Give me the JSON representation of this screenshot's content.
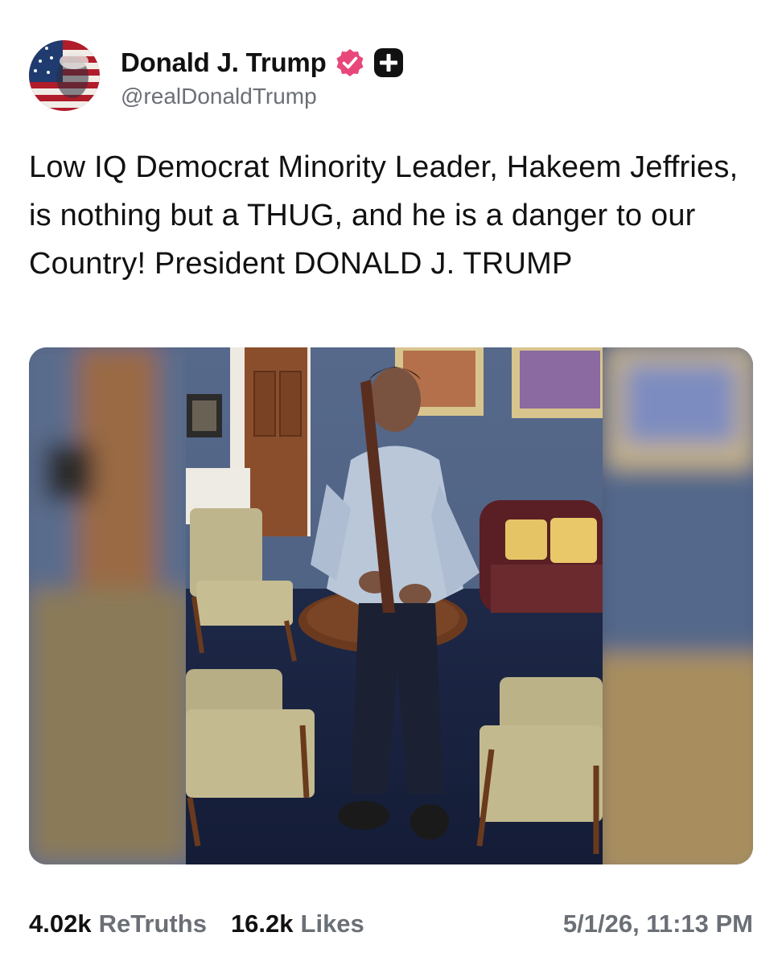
{
  "author": {
    "display_name": "Donald J. Trump",
    "handle": "@realDonaldTrump",
    "avatar_icon": "flag-portrait-avatar",
    "verified_icon": "verified-badge-icon",
    "verified_color": "#e8477a",
    "subscribe_icon": "plus-badge-icon"
  },
  "post": {
    "text": "Low IQ Democrat Minority Leader, Hakeem Jeffries, is nothing but a THUG, and he is a danger to our Country! President DONALD J. TRUMP"
  },
  "media": {
    "type": "photo",
    "subject": "man-holding-baseball-bat-in-office"
  },
  "stats": {
    "retruths_count": "4.02k",
    "retruths_label": "ReTruths",
    "likes_count": "16.2k",
    "likes_label": "Likes"
  },
  "timestamp": "5/1/26, 11:13 PM",
  "colors": {
    "text": "#111111",
    "secondary_text": "#6b6f76",
    "background": "#ffffff"
  }
}
